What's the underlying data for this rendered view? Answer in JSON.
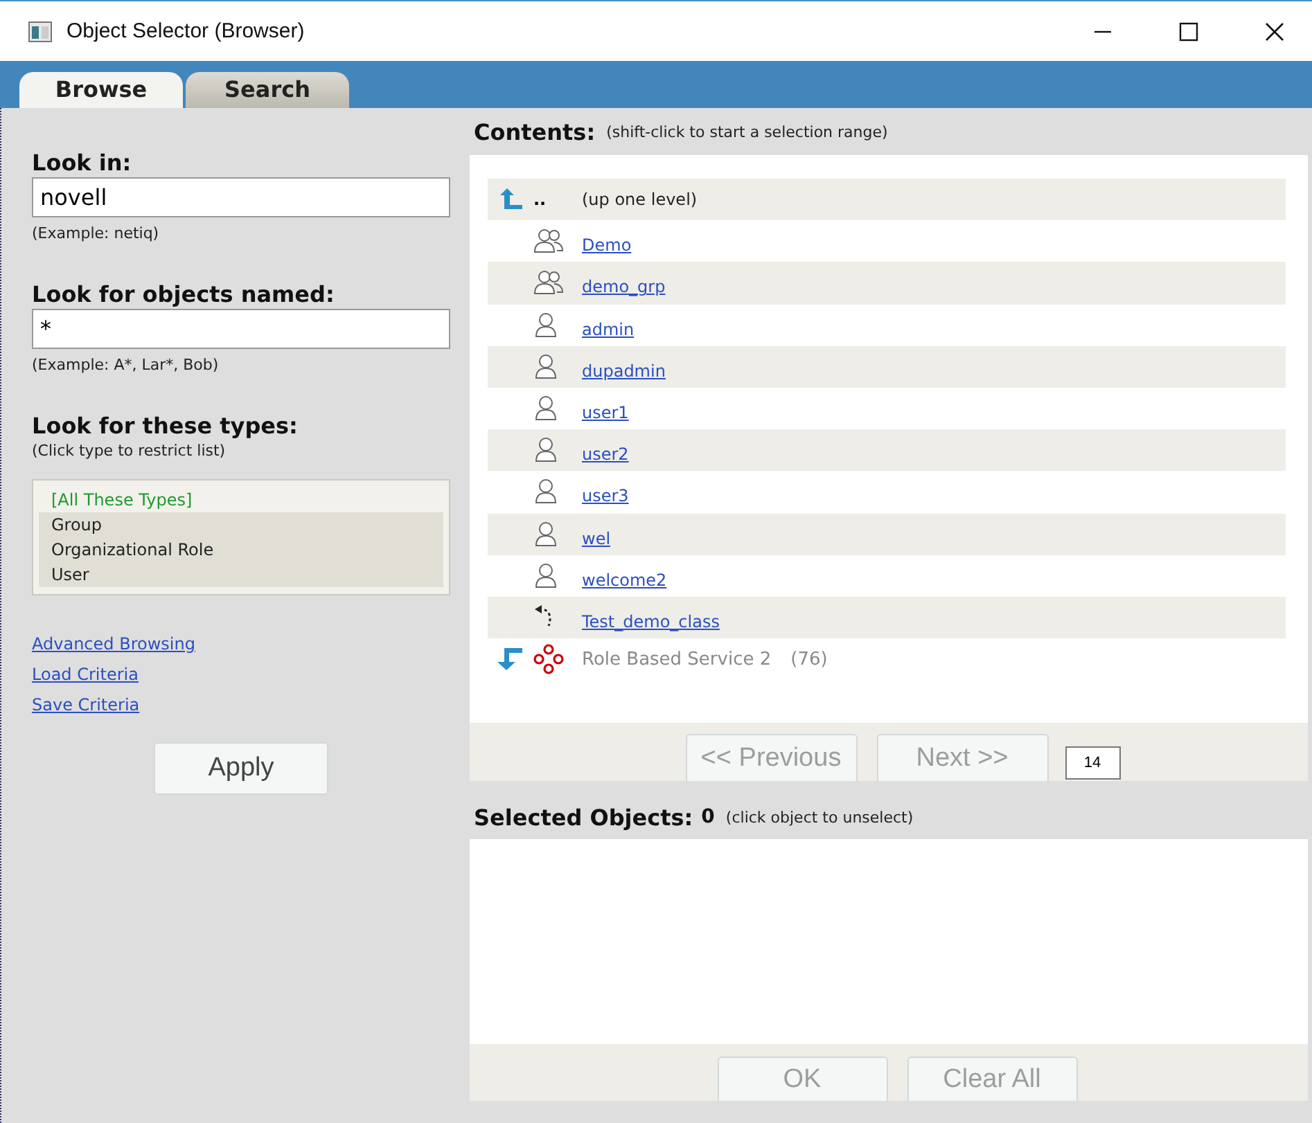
{
  "window": {
    "title": "Object Selector (Browser)"
  },
  "tabs": [
    {
      "label": "Browse",
      "selected": true
    },
    {
      "label": "Search",
      "selected": false
    }
  ],
  "look_in": {
    "label": "Look in:",
    "value": "novell",
    "hint": "(Example: netiq)"
  },
  "objects_named": {
    "label": "Look for objects named:",
    "value": "*",
    "hint": "(Example: A*, Lar*, Bob)"
  },
  "types": {
    "label": "Look for these types:",
    "hint": "(Click type to restrict list)",
    "items": [
      {
        "label": "[All These Types]",
        "selected": true
      },
      {
        "label": "Group",
        "selected": false
      },
      {
        "label": "Organizational Role",
        "selected": false
      },
      {
        "label": "User",
        "selected": false
      }
    ]
  },
  "links": [
    "Advanced Browsing",
    "Load Criteria",
    "Save Criteria"
  ],
  "apply_button": {
    "label": "Apply",
    "disabled": false
  },
  "contents": {
    "title": "Contents:",
    "hint": "(shift-click to start a selection range)",
    "items": [
      {
        "kind": "up",
        "marker": "..",
        "label": "(up one level)"
      },
      {
        "kind": "group",
        "label": "Demo"
      },
      {
        "kind": "group",
        "label": "demo_grp"
      },
      {
        "kind": "user",
        "label": "admin"
      },
      {
        "kind": "user",
        "label": "dupadmin"
      },
      {
        "kind": "user",
        "label": "user1"
      },
      {
        "kind": "user",
        "label": "user2"
      },
      {
        "kind": "user",
        "label": "user3"
      },
      {
        "kind": "user",
        "label": "wel"
      },
      {
        "kind": "user",
        "label": "welcome2"
      },
      {
        "kind": "class",
        "label": "Test_demo_class"
      },
      {
        "kind": "role",
        "label": "Role Based Service 2",
        "count": "(76)"
      }
    ]
  },
  "pager": {
    "previous": {
      "label": "<< Previous",
      "disabled": true
    },
    "next": {
      "label": "Next >>",
      "disabled": true
    },
    "page_size": "14"
  },
  "selected_objects": {
    "title": "Selected Objects:",
    "count": "0",
    "hint": "(click object to unselect)"
  },
  "buttons": [
    {
      "label": "OK",
      "disabled": true
    },
    {
      "label": "Clear All",
      "disabled": true
    }
  ]
}
